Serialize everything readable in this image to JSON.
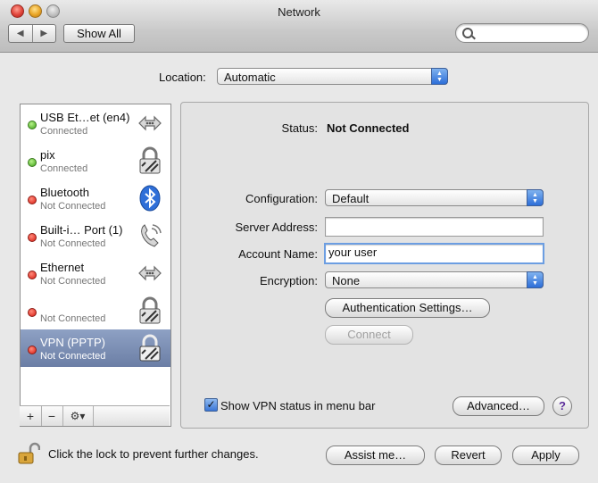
{
  "window": {
    "title": "Network"
  },
  "toolbar": {
    "back": "◀",
    "forward": "▶",
    "show_all": "Show All",
    "search_placeholder": ""
  },
  "location": {
    "label": "Location:",
    "value": "Automatic"
  },
  "services": [
    {
      "name": "USB Et…et (en4)",
      "status": "Connected",
      "state": "green",
      "icon": "ethernet-arrows-icon"
    },
    {
      "name": "pix",
      "status": "Connected",
      "state": "green",
      "icon": "lock-icon"
    },
    {
      "name": "Bluetooth",
      "status": "Not Connected",
      "state": "red",
      "icon": "bluetooth-icon"
    },
    {
      "name": "Built-i… Port (1)",
      "status": "Not Connected",
      "state": "red",
      "icon": "phone-icon"
    },
    {
      "name": "Ethernet",
      "status": "Not Connected",
      "state": "red",
      "icon": "ethernet-arrows-icon"
    },
    {
      "name": "",
      "status": "Not Connected",
      "state": "red",
      "icon": "lock-icon"
    },
    {
      "name": "VPN (PPTP)",
      "status": "Not Connected",
      "state": "red",
      "icon": "lock-icon",
      "selected": true
    }
  ],
  "sidebar_tools": {
    "add": "+",
    "remove": "−",
    "gear": "⚙▾"
  },
  "detail": {
    "status_label": "Status:",
    "status_value": "Not Connected",
    "configuration_label": "Configuration:",
    "configuration_value": "Default",
    "server_label": "Server Address:",
    "server_value": "",
    "account_label": "Account Name:",
    "account_value": "your user",
    "encryption_label": "Encryption:",
    "encryption_value": "None",
    "auth_button": "Authentication Settings…",
    "connect_button": "Connect",
    "show_status_label": "Show VPN status in menu bar",
    "show_status_checked": true,
    "advanced_button": "Advanced…",
    "help": "?"
  },
  "footer": {
    "lock_text": "Click the lock to prevent further changes.",
    "assist_button": "Assist me…",
    "revert_button": "Revert",
    "apply_button": "Apply"
  }
}
